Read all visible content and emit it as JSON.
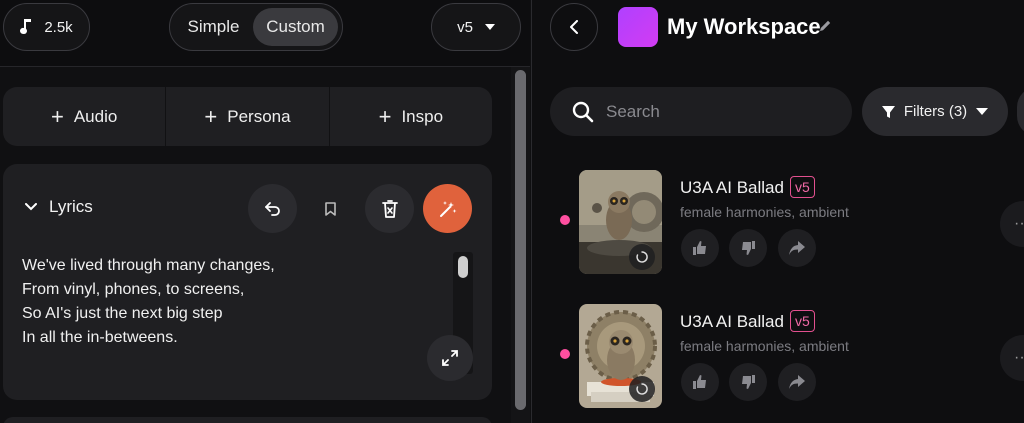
{
  "topbar": {
    "play_count": "2.5k",
    "mode_simple": "Simple",
    "mode_custom": "Custom",
    "version": "v5"
  },
  "attach": {
    "audio": "Audio",
    "persona": "Persona",
    "inspo": "Inspo"
  },
  "lyrics": {
    "label": "Lyrics",
    "lines": [
      "We've lived through many changes,",
      "From vinyl, phones, to screens,",
      "So AI's just the next big step",
      "In all the in-betweens."
    ]
  },
  "workspace": {
    "title": "My Workspace",
    "search_placeholder": "Search",
    "filters_label": "Filters (3)"
  },
  "songs": [
    {
      "title": "U3A AI Ballad",
      "version": "v5",
      "tags": "female harmonies, ambient"
    },
    {
      "title": "U3A AI Ballad",
      "version": "v5",
      "tags": "female harmonies, ambient"
    }
  ],
  "colors": {
    "accent_orange": "#e0623c",
    "accent_pink": "#ff4fa0",
    "workspace_purple": "#c03cf8"
  }
}
